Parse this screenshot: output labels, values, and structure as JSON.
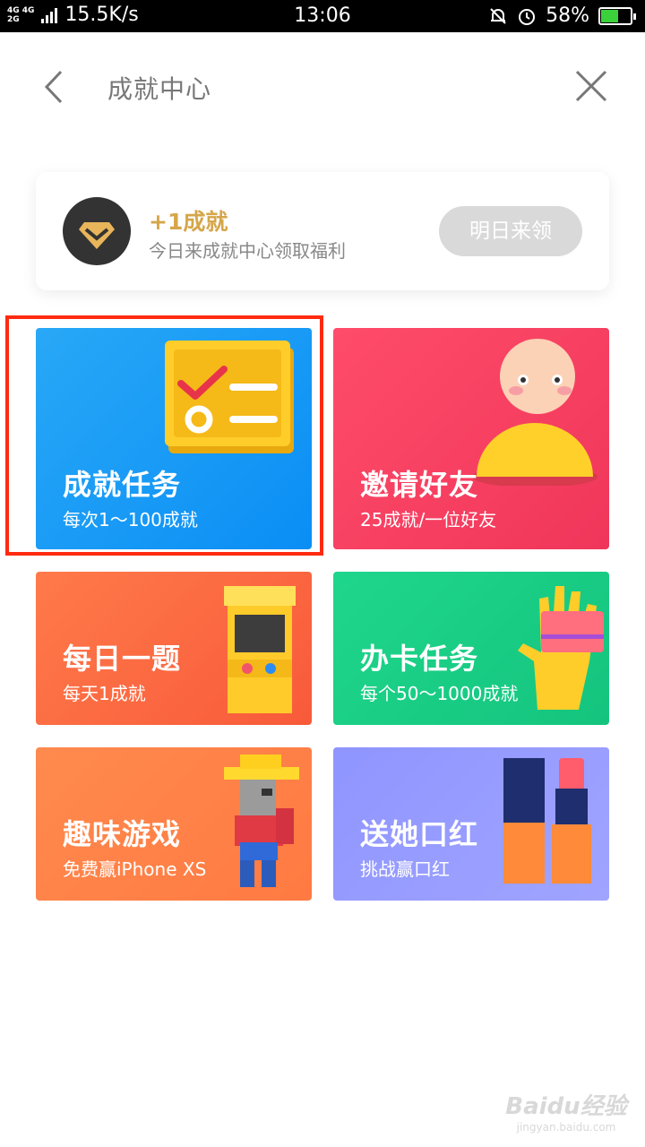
{
  "status_bar": {
    "network_label_top": "4G 4G",
    "network_label_bottom": "2G",
    "speed": "15.5K/s",
    "time": "13:06",
    "battery_percent": "58%",
    "battery_level": 0.58
  },
  "nav": {
    "title": "成就中心",
    "back_icon": "chevron-left-icon",
    "close_icon": "close-icon"
  },
  "reward": {
    "title": "+1成就",
    "subtitle": "今日来成就中心领取福利",
    "button_label": "明日来领",
    "icon": "medal-icon",
    "title_color": "#d5a64a"
  },
  "tiles": [
    {
      "title": "成就任务",
      "subtitle": "每次1～100成就",
      "color": "#1a9bf6"
    },
    {
      "title": "邀请好友",
      "subtitle": "25成就/一位好友",
      "color": "#f43f60"
    },
    {
      "title": "每日一题",
      "subtitle": "每天1成就",
      "color": "#fb6a42"
    },
    {
      "title": "办卡任务",
      "subtitle": "每个50～1000成就",
      "color": "#18cd85"
    },
    {
      "title": "趣味游戏",
      "subtitle": "免费赢iPhone XS",
      "color": "#ff8246"
    },
    {
      "title": "送她口红",
      "subtitle": "挑战赢口红",
      "color": "#979cff"
    }
  ],
  "watermark": {
    "main": "Baidu经验",
    "sub": "jingyan.baidu.com"
  }
}
